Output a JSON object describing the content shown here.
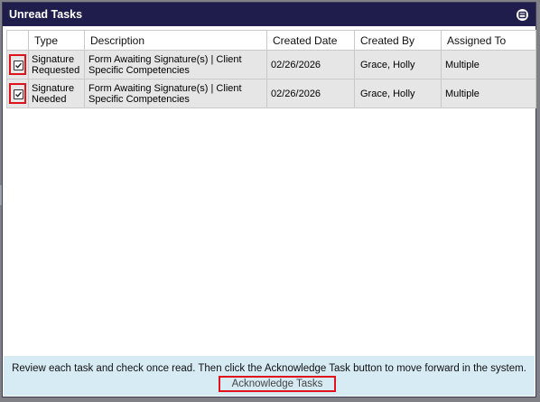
{
  "window": {
    "title": "Unread Tasks",
    "minimize_icon": "minimize-icon"
  },
  "table": {
    "columns": [
      "",
      "Type",
      "Description",
      "Created Date",
      "Created By",
      "Assigned To"
    ],
    "rows": [
      {
        "checked": true,
        "type": "Signature Requested",
        "description": "Form Awaiting Signature(s) | Client Specific Competencies",
        "created_date": "02/26/2026",
        "created_by": "Grace, Holly",
        "assigned_to": "Multiple"
      },
      {
        "checked": true,
        "type": "Signature Needed",
        "description": "Form Awaiting Signature(s) | Client Specific Competencies",
        "created_date": "02/26/2026",
        "created_by": "Grace, Holly",
        "assigned_to": "Multiple"
      }
    ]
  },
  "footer": {
    "message": "Review each task and check once read. Then click the Acknowledge Task button to move forward in the system.",
    "acknowledge_label": "Acknowledge Tasks"
  },
  "colors": {
    "titlebar": "#1f1d4b",
    "highlight": "#e0131c",
    "footer_bg": "#d7ebf5",
    "row_bg": "#e6e6e6"
  }
}
